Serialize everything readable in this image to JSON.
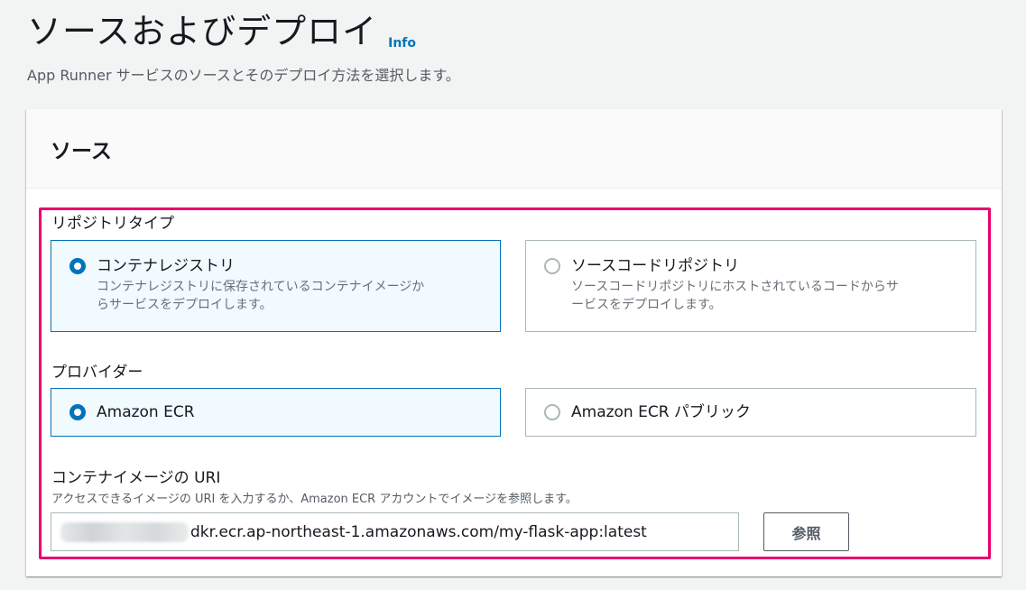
{
  "header": {
    "title": "ソースおよびデプロイ",
    "info_link": "Info",
    "description": "App Runner サービスのソースとそのデプロイ方法を選択します。"
  },
  "panel": {
    "title": "ソース"
  },
  "repository_type": {
    "label": "リポジトリタイプ",
    "options": [
      {
        "title": "コンテナレジストリ",
        "description_line1": "コンテナレジストリに保存されているコンテナイメージか",
        "description_line2": "らサービスをデプロイします。",
        "selected": true
      },
      {
        "title": "ソースコードリポジトリ",
        "description_line1": "ソースコードリポジトリにホストされているコードからサ",
        "description_line2": "ービスをデプロイします。",
        "selected": false
      }
    ]
  },
  "provider": {
    "label": "プロバイダー",
    "options": [
      {
        "title": "Amazon ECR",
        "selected": true
      },
      {
        "title": "Amazon ECR パブリック",
        "selected": false
      }
    ]
  },
  "image_uri": {
    "label": "コンテナイメージの URI",
    "description": "アクセスできるイメージの URI を入力するか、Amazon ECR アカウントでイメージを参照します。",
    "value_visible": "dkr.ecr.ap-northeast-1.amazonaws.com/my-flask-app:latest",
    "browse_label": "参照"
  },
  "colors": {
    "accent": "#0073bb",
    "highlight": "#e8006e",
    "selected_bg": "#f1faff"
  }
}
